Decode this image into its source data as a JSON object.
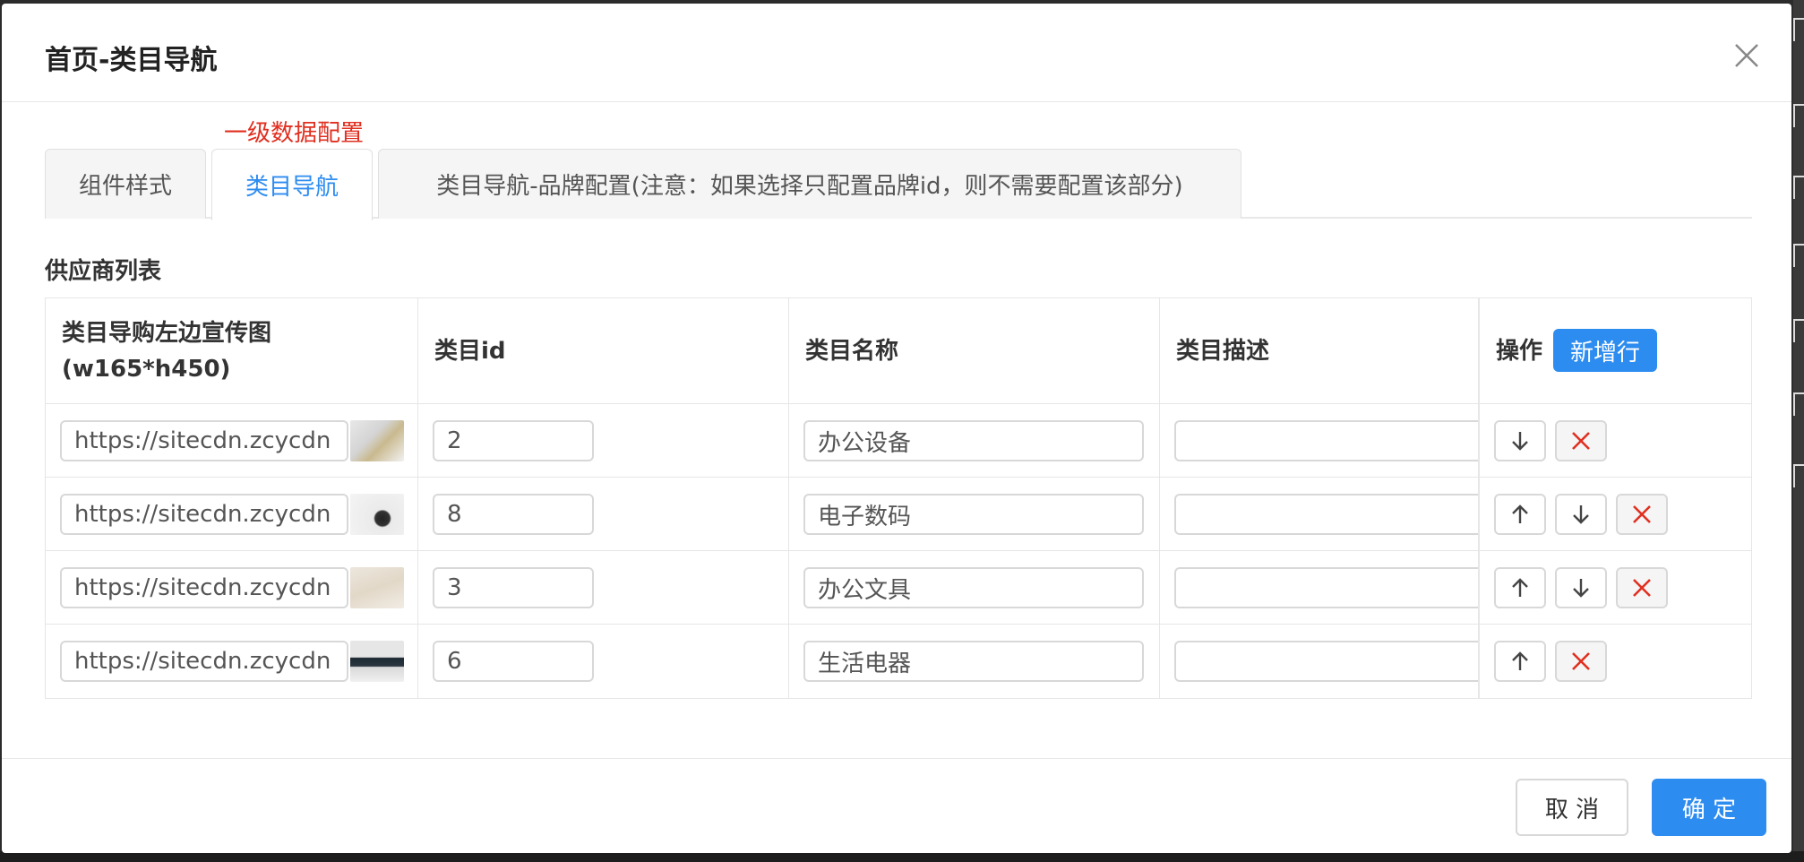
{
  "modal": {
    "title": "首页-类目导航",
    "hint": "一级数据配置",
    "tabs": [
      {
        "label": "组件样式"
      },
      {
        "label": "类目导航"
      },
      {
        "label": "类目导航-品牌配置(注意：如果选择只配置品牌id，则不需要配置该部分)"
      }
    ],
    "active_tab": "类目导航",
    "section_title": "供应商列表",
    "table": {
      "headers": {
        "image": "类目导购左边宣传图",
        "image_size": "(w165*h450)",
        "id": "类目id",
        "name": "类目名称",
        "desc": "类目描述",
        "ops": "操作",
        "add_row": "新增行"
      },
      "rows": [
        {
          "url": "https://sitecdn.zcycdn",
          "id": "2",
          "name": "办公设备",
          "desc": "",
          "up": false,
          "down": true
        },
        {
          "url": "https://sitecdn.zcycdn",
          "id": "8",
          "name": "电子数码",
          "desc": "",
          "up": true,
          "down": true
        },
        {
          "url": "https://sitecdn.zcycdn",
          "id": "3",
          "name": "办公文具",
          "desc": "",
          "up": true,
          "down": true
        },
        {
          "url": "https://sitecdn.zcycdn",
          "id": "6",
          "name": "生活电器",
          "desc": "",
          "up": true,
          "down": false
        }
      ]
    },
    "footer": {
      "cancel": "取 消",
      "ok": "确 定"
    }
  },
  "colors": {
    "primary": "#2d8cf0",
    "danger": "#e02f20",
    "border": "#e6e6e6"
  },
  "icons": {
    "close": "close-icon",
    "up": "arrow-up-icon",
    "down": "arrow-down-icon",
    "delete": "delete-x-icon"
  }
}
